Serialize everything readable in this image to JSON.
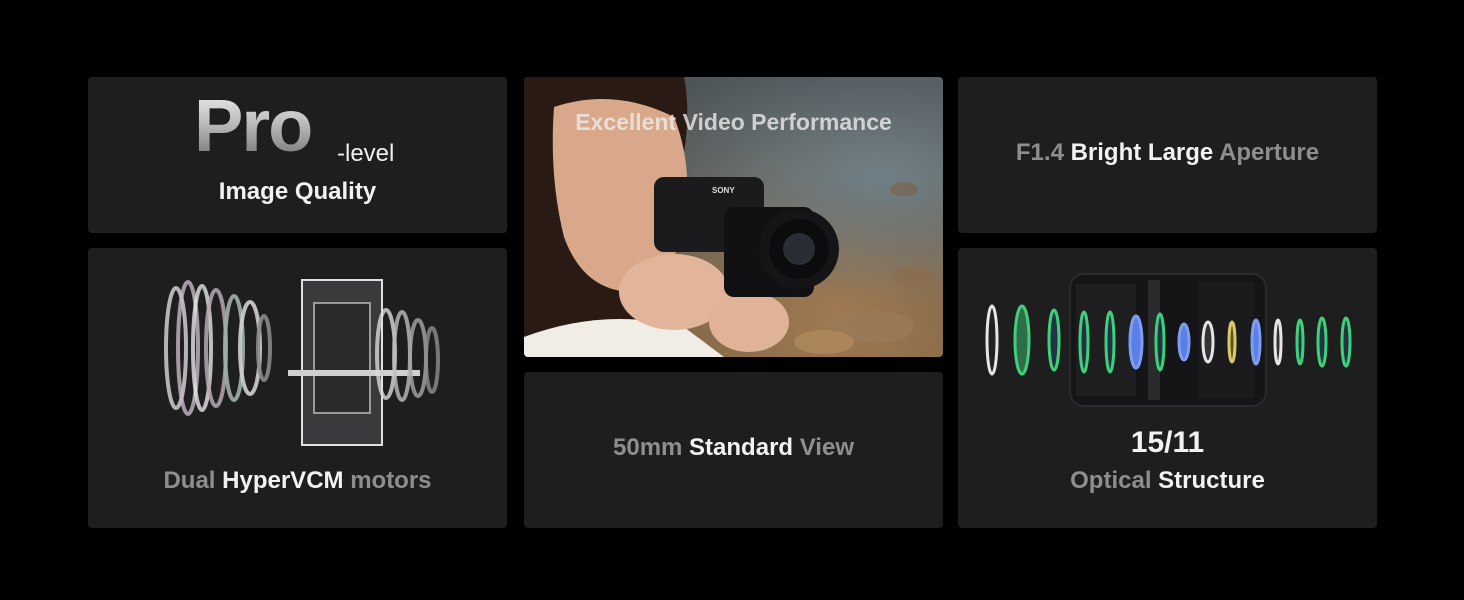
{
  "tiles": {
    "pro": {
      "big": "Pro",
      "suffix": "-level",
      "subtitle": "Image Quality"
    },
    "video": {
      "title": "Excellent Video Performance",
      "camera_brand": "SONY"
    },
    "aperture": {
      "pre": "F1.4",
      "bold": "Bright Large",
      "post": "Aperture"
    },
    "motors": {
      "pre": "Dual",
      "bold": "HyperVCM",
      "post": "motors"
    },
    "standard": {
      "pre": "50mm",
      "bold": "Standard",
      "post": "View"
    },
    "optical": {
      "number": "15/11",
      "pre": "Optical",
      "bold": "Structure"
    }
  },
  "colors": {
    "background": "#000000",
    "tile": "#1e1e1e",
    "text_grey": "#8e8e8e",
    "text_white": "#f2f2f2",
    "lens_green": "#3fd07a",
    "lens_blue": "#5a7fe6",
    "lens_yellow": "#d9c96a"
  }
}
